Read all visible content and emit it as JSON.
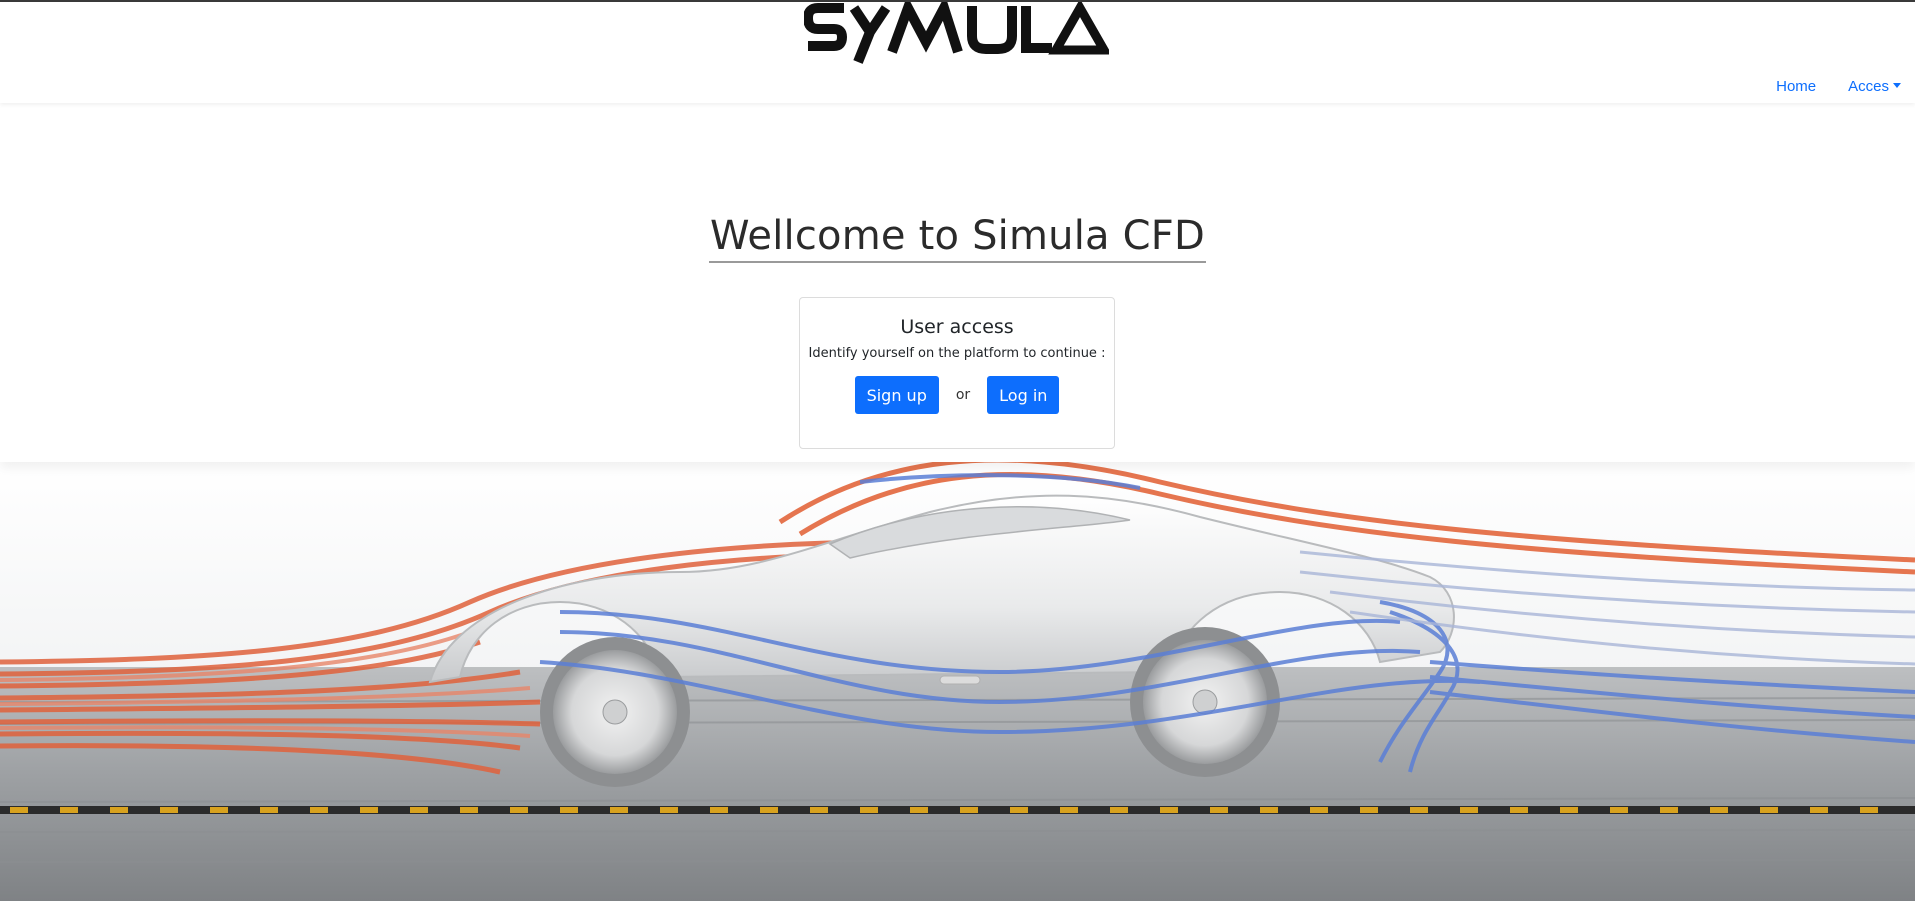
{
  "brand": {
    "logo_text": "SYMULA"
  },
  "nav": {
    "home_label": "Home",
    "access_label": "Acces"
  },
  "hero": {
    "title": "Wellcome to Simula CFD"
  },
  "access_card": {
    "title": "User access",
    "text": "Identify yourself on the platform to continue :",
    "signup_label": "Sign up",
    "or_label": "or",
    "login_label": "Log in"
  },
  "colors": {
    "link": "#0d6efd",
    "button": "#0d6efd",
    "flow_warm": "#e0623c",
    "flow_cool": "#5b7fd6"
  }
}
